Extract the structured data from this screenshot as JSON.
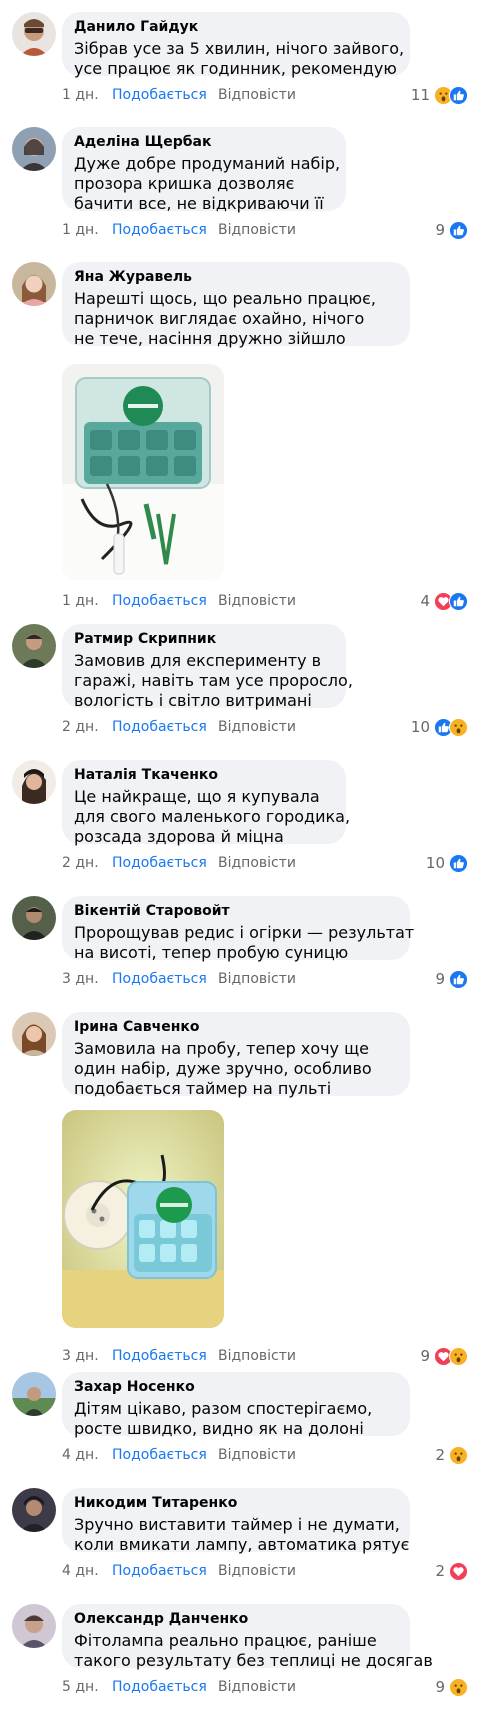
{
  "ui": {
    "like_label": "Подобається",
    "reply_label": "Відповісти"
  },
  "comments": [
    {
      "author": "Данило Гайдук",
      "lines": [
        "Зібрав усе за 5 хвилин, нічого зайвого,",
        "усе працює як годинник, рекомендую"
      ],
      "time": "1 дн.",
      "count": "11",
      "reactions": [
        "wow",
        "like"
      ]
    },
    {
      "author": "Аделіна Щербак",
      "lines": [
        "Дуже добре продуманий набір,",
        "прозора кришка дозволяє",
        "бачити все, не відкриваючи її"
      ],
      "time": "1 дн.",
      "count": "9",
      "reactions": [
        "like"
      ]
    },
    {
      "author": "Яна Журавель",
      "lines": [
        "Нарешті щось, що реально працює,",
        "парничок виглядає охайно, нічого",
        "не тече, насіння дружно зійшло"
      ],
      "time": "1 дн.",
      "count": "4",
      "reactions": [
        "love",
        "like"
      ]
    },
    {
      "author": "Ратмир Скрипник",
      "lines": [
        "Замовив для експерименту в",
        "гаражі, навіть там усе проросло,",
        "вологість і світло витримані"
      ],
      "time": "2 дн.",
      "count": "10",
      "reactions": [
        "like",
        "wow"
      ]
    },
    {
      "author": "Наталія Ткаченко",
      "lines": [
        "Це найкраще, що я купувала",
        "для свого маленького городика,",
        "розсада здорова й міцна"
      ],
      "time": "2 дн.",
      "count": "10",
      "reactions": [
        "like"
      ]
    },
    {
      "author": "Вікентій Старовойт",
      "lines": [
        "Пророщував редис і огірки — результат",
        "на висоті, тепер пробую суницю"
      ],
      "time": "3 дн.",
      "count": "9",
      "reactions": [
        "like"
      ]
    },
    {
      "author": "Ірина Савченко",
      "lines": [
        "Замовила на пробу, тепер хочу ще",
        "один набір, дуже зручно, особливо",
        "подобається таймер на пульті"
      ],
      "time": "3 дн.",
      "count": "9",
      "reactions": [
        "love",
        "wow"
      ]
    },
    {
      "author": "Захар Носенко",
      "lines": [
        "Дітям цікаво, разом спостерігаємо,",
        "росте швидко, видно як на долоні"
      ],
      "time": "4 дн.",
      "count": "2",
      "reactions": [
        "wow"
      ]
    },
    {
      "author": "Никодим Титаренко",
      "lines": [
        "Зручно виставити таймер і не думати,",
        "коли вмикати лампу, автоматика рятує"
      ],
      "time": "4 дн.",
      "count": "2",
      "reactions": [
        "love"
      ]
    },
    {
      "author": "Олександр Данченко",
      "lines": [
        "Фітолампа реально працює, раніше",
        "такого результату без теплиці не досягав"
      ],
      "time": "5 дн.",
      "count": "9",
      "reactions": [
        "wow"
      ]
    }
  ],
  "colors": {
    "accent": "#1877f2",
    "bubble": "#f0f2f5",
    "meta": "#65676b",
    "love": "#f33e58",
    "wow": "#f7b125"
  }
}
